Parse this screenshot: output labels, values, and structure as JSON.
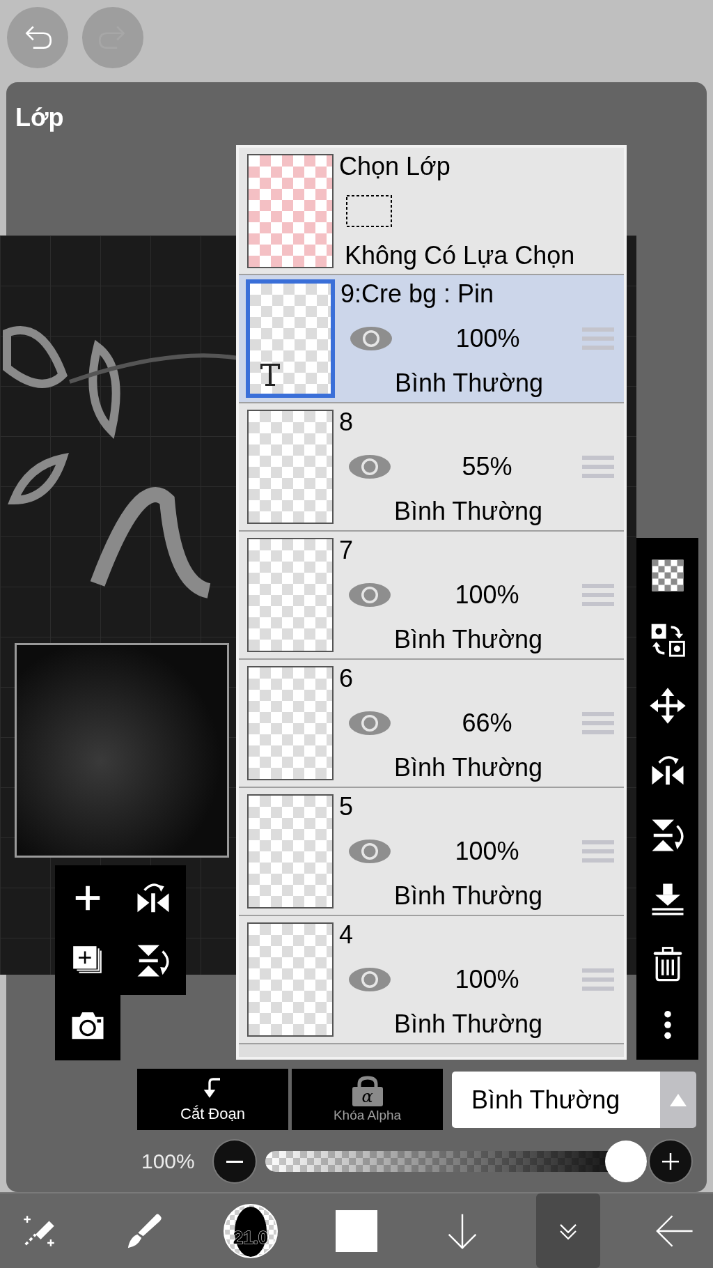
{
  "top_bar": {
    "undo": {
      "disabled": false
    },
    "redo": {
      "disabled": true
    }
  },
  "panel": {
    "title": "Lớp"
  },
  "selection_layer": {
    "title": "Chọn Lớp",
    "status": "Không Có Lựa Chọn"
  },
  "layers": [
    {
      "name": "9:Cre bg : Pin",
      "opacity": "100%",
      "blend": "Bình Thường",
      "visible": true,
      "selected": true,
      "kind": "text"
    },
    {
      "name": "8",
      "opacity": "55%",
      "blend": "Bình Thường",
      "visible": true,
      "selected": false,
      "kind": "raster"
    },
    {
      "name": "7",
      "opacity": "100%",
      "blend": "Bình Thường",
      "visible": true,
      "selected": false,
      "kind": "raster"
    },
    {
      "name": "6",
      "opacity": "66%",
      "blend": "Bình Thường",
      "visible": true,
      "selected": false,
      "kind": "raster"
    },
    {
      "name": "5",
      "opacity": "100%",
      "blend": "Bình Thường",
      "visible": true,
      "selected": false,
      "kind": "raster"
    },
    {
      "name": "4",
      "opacity": "100%",
      "blend": "Bình Thường",
      "visible": true,
      "selected": false,
      "kind": "raster"
    }
  ],
  "clipping_button": {
    "label": "Cắt Đoạn",
    "disabled": false
  },
  "alpha_lock_button": {
    "label": "Khóa Alpha",
    "icon_text": "α",
    "disabled": true
  },
  "blend_mode": {
    "value": "Bình Thường"
  },
  "opacity": {
    "reading": "100%",
    "level": 1.0
  },
  "bottom_toolbar": {
    "items": [
      {
        "kind": "select-erase",
        "selected": false
      },
      {
        "kind": "brush",
        "selected": false
      },
      {
        "kind": "brush-size",
        "label": "21.0",
        "selected": false
      },
      {
        "kind": "color",
        "selected": false
      },
      {
        "kind": "down-arrow",
        "selected": false
      },
      {
        "kind": "double-chevron",
        "selected": true
      },
      {
        "kind": "back-arrow",
        "selected": false
      }
    ]
  }
}
